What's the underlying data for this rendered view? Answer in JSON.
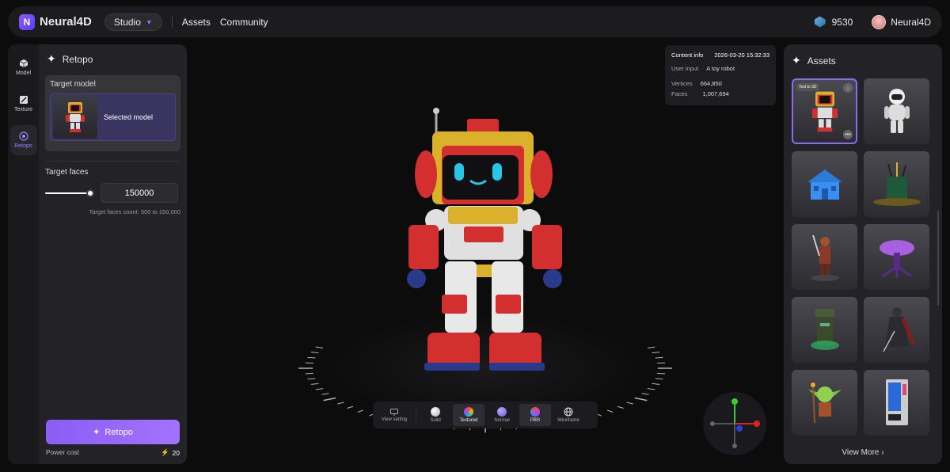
{
  "app": {
    "brand": "Neural4D",
    "mode_button": "Studio",
    "nav": [
      "Assets",
      "Community"
    ],
    "credits": "9530",
    "username": "Neural4D"
  },
  "rail": [
    {
      "label": "Model",
      "icon": "cube-icon",
      "active": false
    },
    {
      "label": "Texture",
      "icon": "brush-icon",
      "active": false
    },
    {
      "label": "Retopo",
      "icon": "retopo-icon",
      "active": true
    }
  ],
  "left_panel": {
    "title": "Retopo",
    "target_model_label": "Target model",
    "selected_model_label": "Selected model",
    "target_faces_label": "Target faces",
    "target_faces_value": "150000",
    "target_faces_fraction": 1.0,
    "hint": "Target faces count: 500 to 150,000",
    "action_label": "Retopo",
    "power_cost_label": "Power cost",
    "power_cost_value": "20"
  },
  "content_info": {
    "title": "Content info",
    "timestamp": "2026-03-20 15:32:33",
    "user_input_label": "User input",
    "user_input_value": "A toy robot",
    "vertices_label": "Vertices",
    "vertices_value": "664,850",
    "faces_label": "Faces",
    "faces_value": "1,007,694"
  },
  "view_toolbar": [
    {
      "label": "View setting",
      "icon": "monitor-icon",
      "on": false
    },
    {
      "label": "Solid",
      "icon": "solid-sphere-icon",
      "on": false
    },
    {
      "label": "Textured",
      "icon": "textured-sphere-icon",
      "on": true
    },
    {
      "label": "Normal",
      "icon": "normal-sphere-icon",
      "on": false
    },
    {
      "label": "PBR",
      "icon": "pbr-sphere-icon",
      "on": true
    },
    {
      "label": "Wireframe",
      "icon": "globe-icon",
      "on": false
    }
  ],
  "assets": {
    "title": "Assets",
    "first_badge": "Text to 3D",
    "view_more": "View More",
    "items": [
      "toy robot",
      "astronaut",
      "blue house",
      "pen holder",
      "warrior",
      "mushroom creature",
      "totem",
      "dark knight",
      "goblin",
      "vending machine"
    ]
  },
  "colors": {
    "accent": "#8b5df5",
    "bg": "#0c0c0d",
    "panel": "#232327"
  }
}
